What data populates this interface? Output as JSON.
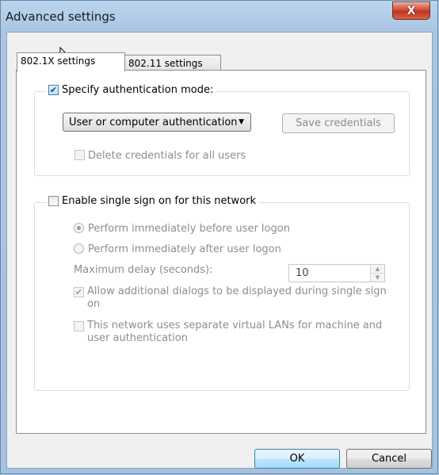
{
  "window": {
    "title": "Advanced settings",
    "close_glyph": "X"
  },
  "tabs": [
    {
      "label": "802.1X settings",
      "active": true
    },
    {
      "label": "802.11 settings",
      "active": false
    }
  ],
  "auth_group": {
    "specify_mode_label": "Specify authentication mode:",
    "specify_mode_checked": true,
    "mode_select_value": "User or computer authentication",
    "save_credentials_label": "Save credentials",
    "delete_credentials_label": "Delete credentials for all users"
  },
  "sso_group": {
    "enable_sso_label": "Enable single sign on for this network",
    "radio_before_label": "Perform immediately before user logon",
    "radio_after_label": "Perform immediately after user logon",
    "max_delay_label": "Maximum delay (seconds):",
    "max_delay_value": "10",
    "allow_dialogs_label": "Allow additional dialogs to be displayed during single sign on",
    "separate_vlans_label": "This network uses separate virtual LANs for machine and user authentication"
  },
  "buttons": {
    "ok_label": "OK",
    "cancel_label": "Cancel"
  },
  "colors": {
    "window_frame": "#a9c5e2",
    "close_button": "#c7452b",
    "dialog_background": "#f0f0f0"
  },
  "icons": {
    "close": "close-icon",
    "cursor": "mouse-cursor-icon",
    "dropdown": "chevron-down-icon"
  }
}
